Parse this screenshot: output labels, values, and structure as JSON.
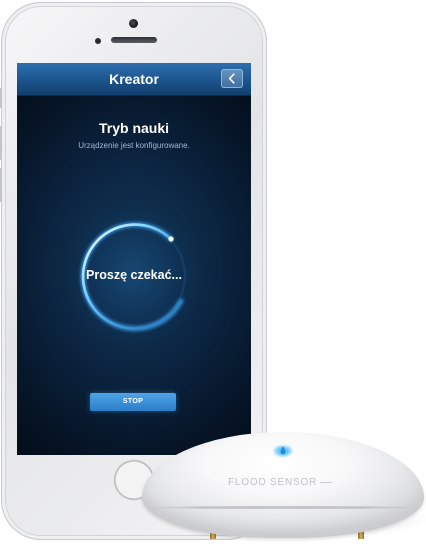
{
  "app": {
    "navbar_title": "Kreator",
    "back_icon": "chevron-left-icon"
  },
  "screen": {
    "heading": "Tryb nauki",
    "subheading": "Urządzenie jest konfigurowane.",
    "spinner_label": "Proszę czekać...",
    "stop_label": "STOP"
  },
  "device": {
    "label": "FLOOD SENSOR",
    "led_icon": "water-drop-icon"
  },
  "colors": {
    "accent": "#2b7ec7",
    "navbar": "#1c548d",
    "screen_background": "#0b2440",
    "led": "#3ab4ff"
  }
}
